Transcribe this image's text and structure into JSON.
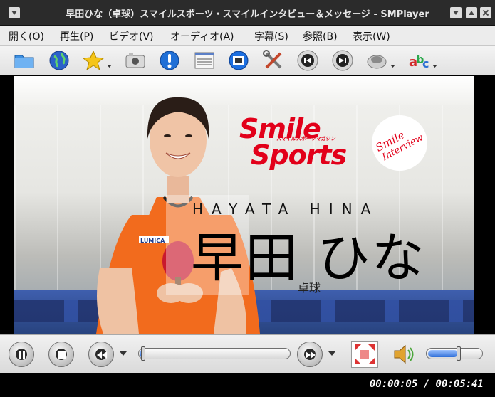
{
  "window": {
    "title": "早田ひな（卓球）スマイルスポーツ・スマイルインタビュー＆メッセージ - SMPlayer"
  },
  "menu": {
    "items": [
      {
        "label": "開く(O)"
      },
      {
        "label": "再生(P)"
      },
      {
        "label": "ビデオ(V)"
      },
      {
        "label": "オーディオ(A)"
      },
      {
        "label": "字幕(S)"
      },
      {
        "label": "参照(B)"
      },
      {
        "label": "表示(W)"
      }
    ]
  },
  "toolbar": {
    "icons": [
      "folder-icon",
      "globe-icon",
      "favorites-star-icon",
      "screenshot-camera-icon",
      "info-icon",
      "playlist-icon",
      "video-settings-icon",
      "tools-icon",
      "previous-icon",
      "next-icon",
      "audio-icon",
      "subtitles-icon"
    ]
  },
  "video_overlay": {
    "brand_smile": "Smile",
    "brand_sports": "Sports",
    "brand_sub": "スマイルスポーツマガジン",
    "badge_line1": "Smile",
    "badge_line2": "Interview",
    "name_romaji": "HAYATA HINA",
    "name_kanji": "早田 ひな",
    "sport": "卓球"
  },
  "controls": {
    "seek_progress": 0.015,
    "volume_level": 0.55
  },
  "status": {
    "time": "00:00:05 / 00:05:41"
  },
  "colors": {
    "brand_red": "#e2001a",
    "seek_fill": "#2f6fd8"
  }
}
